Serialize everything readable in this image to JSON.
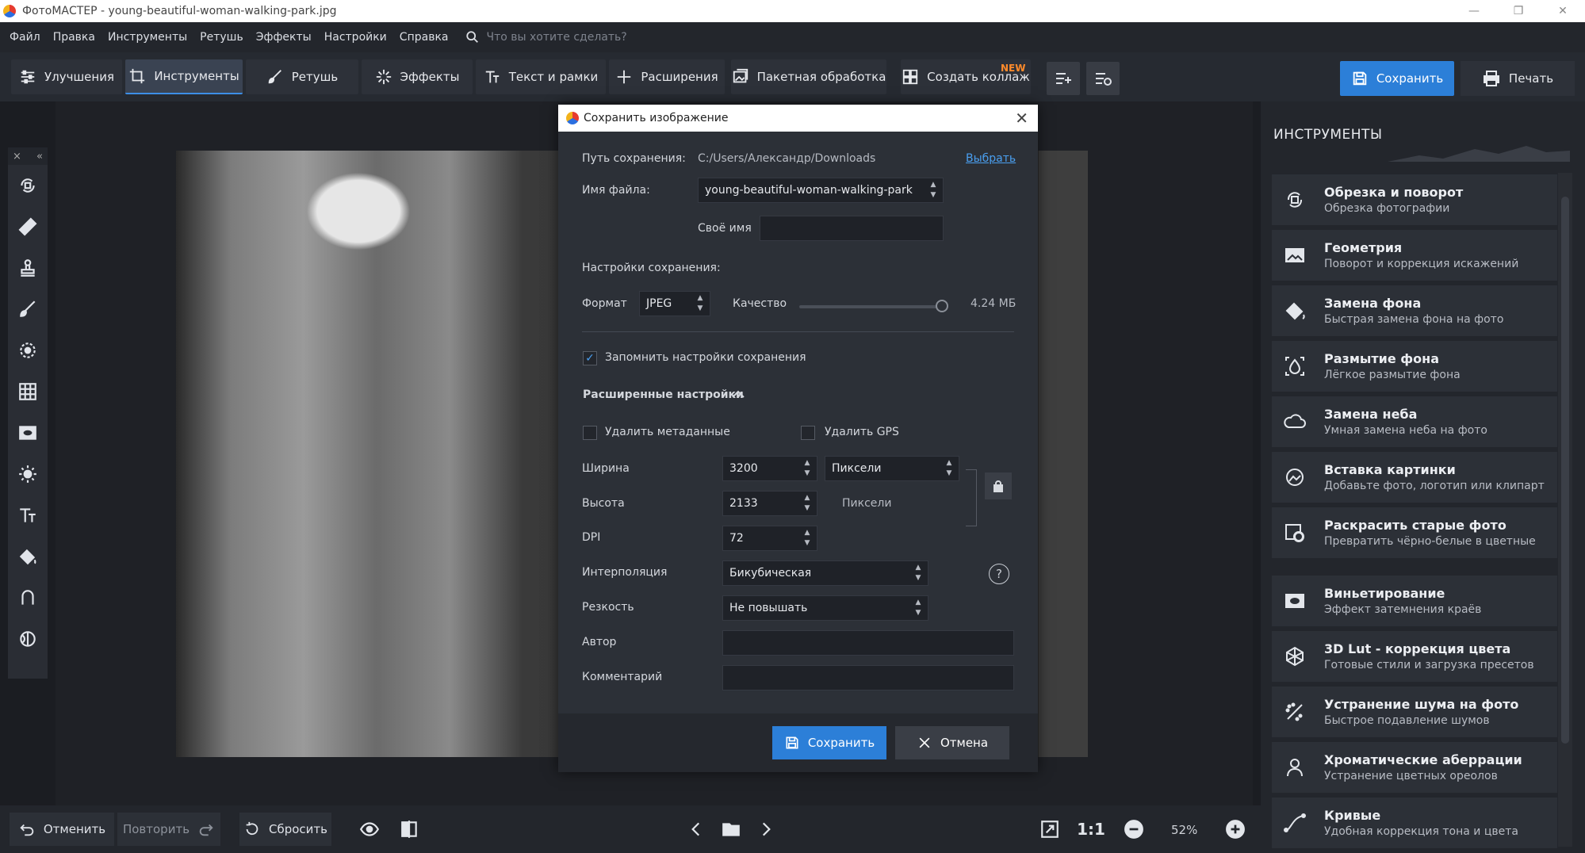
{
  "window": {
    "title": "ФотоМАСТЕР - young-beautiful-woman-walking-park.jpg"
  },
  "menu": {
    "items": [
      "Файл",
      "Правка",
      "Инструменты",
      "Ретушь",
      "Эффекты",
      "Настройки",
      "Справка"
    ],
    "search_placeholder": "Что вы хотите сделать?"
  },
  "toolbar": {
    "enhance": "Улучшения",
    "tools": "Инструменты",
    "retouch": "Ретушь",
    "effects": "Эффекты",
    "text": "Текст и рамки",
    "extensions": "Расширения",
    "batch": "Пакетная обработка",
    "collage": "Создать коллаж",
    "new_badge": "NEW",
    "save": "Сохранить",
    "print": "Печать"
  },
  "left_panel": {
    "close": "×",
    "collapse": "«"
  },
  "right_panel": {
    "title": "ИНСТРУМЕНТЫ",
    "items": [
      {
        "name": "Обрезка и поворот",
        "sub": "Обрезка фотографии",
        "icon": "crop-rotate-icon"
      },
      {
        "name": "Геометрия",
        "sub": "Поворот и коррекция искажений",
        "icon": "geometry-icon"
      },
      {
        "name": "Замена фона",
        "sub": "Быстрая замена фона на фото",
        "icon": "bg-replace-icon"
      },
      {
        "name": "Размытие фона",
        "sub": "Лёгкое размытие фона",
        "icon": "bg-blur-icon"
      },
      {
        "name": "Замена неба",
        "sub": "Умная замена неба на фото",
        "icon": "sky-replace-icon"
      },
      {
        "name": "Вставка картинки",
        "sub": "Добавьте фото, логотип или клипарт",
        "icon": "insert-image-icon"
      },
      {
        "name": "Раскрасить старые фото",
        "sub": "Превратить чёрно-белые в цветные",
        "icon": "colorize-icon"
      },
      {
        "name": "Виньетирование",
        "sub": "Эффект затемнения краёв",
        "icon": "vignette-icon"
      },
      {
        "name": "3D Lut - коррекция цвета",
        "sub": "Готовые стили и загрузка пресетов",
        "icon": "lut-icon"
      },
      {
        "name": "Устранение шума на фото",
        "sub": "Быстрое подавление шумов",
        "icon": "denoise-icon"
      },
      {
        "name": "Хроматические аберрации",
        "sub": "Устранение цветных ореолов",
        "icon": "chromatic-icon"
      },
      {
        "name": "Кривые",
        "sub": "Удобная коррекция тона и цвета",
        "icon": "curves-icon"
      }
    ]
  },
  "bottom": {
    "undo": "Отменить",
    "redo": "Повторить",
    "reset": "Сбросить",
    "one_to_one": "1:1",
    "zoom": "52%"
  },
  "dialog": {
    "title": "Сохранить изображение",
    "path_label": "Путь сохранения:",
    "path_value": "C:/Users/Александр/Downloads",
    "choose": "Выбрать",
    "filename_label": "Имя файла:",
    "filename_value": "young-beautiful-woman-walking-park",
    "custom_name_label": "Своё имя",
    "custom_name_value": "",
    "settings_label": "Настройки сохранения:",
    "format_label": "Формат",
    "format_value": "JPEG",
    "quality_label": "Качество",
    "quality_level": 1.0,
    "size": "4.24 МБ",
    "remember": "Запомнить настройки сохранения",
    "advanced": "Расширенные настройки",
    "remove_meta": "Удалить метаданные",
    "remove_gps": "Удалить GPS",
    "width_label": "Ширина",
    "width_value": "3200",
    "unit_value": "Пиксели",
    "height_label": "Высота",
    "height_value": "2133",
    "height_unit": "Пиксели",
    "dpi_label": "DPI",
    "dpi_value": "72",
    "interp_label": "Интерполяция",
    "interp_value": "Бикубическая",
    "sharp_label": "Резкость",
    "sharp_value": "Не повышать",
    "author_label": "Автор",
    "author_value": "",
    "comment_label": "Комментарий",
    "comment_value": "",
    "help": "?",
    "save": "Сохранить",
    "cancel": "Отмена"
  },
  "colors": {
    "accent": "#2c7fd8",
    "badge": "#ff8b2b",
    "link": "#4a9ff0"
  }
}
